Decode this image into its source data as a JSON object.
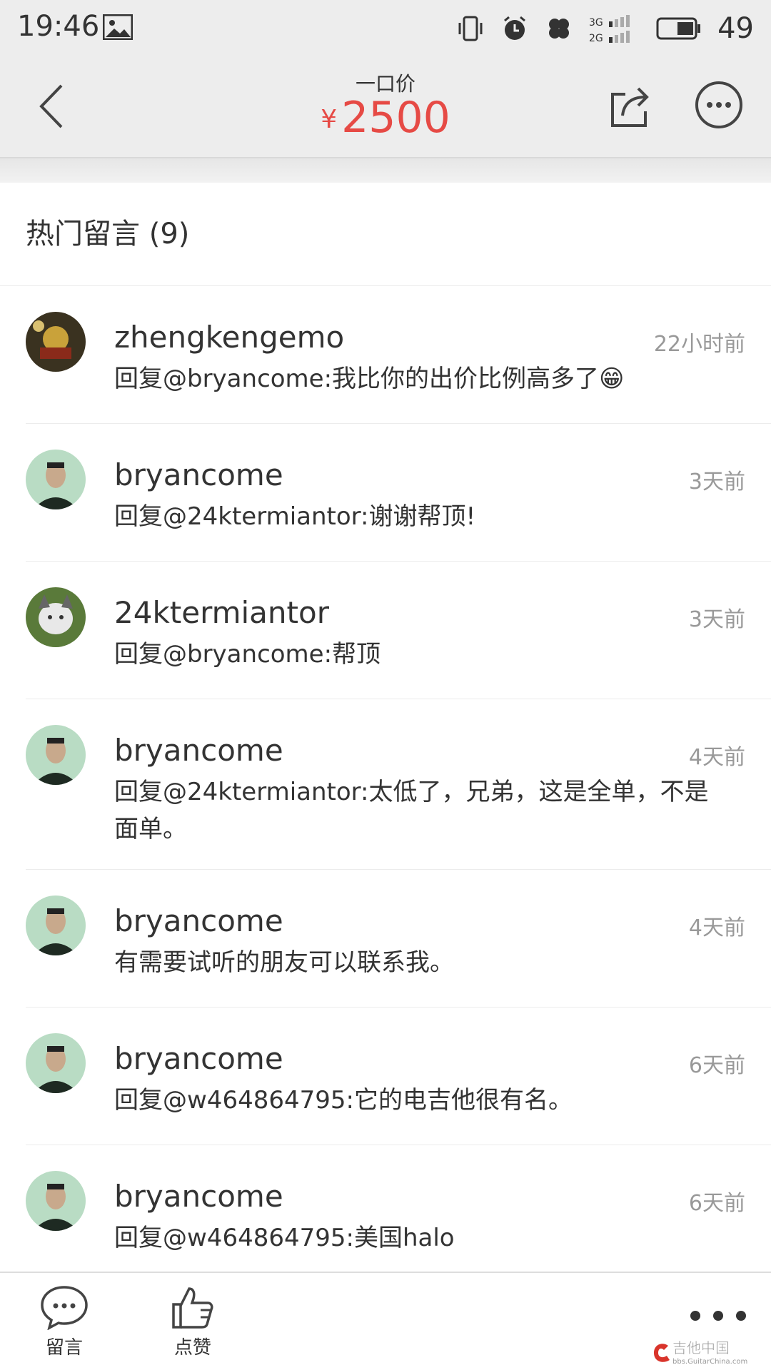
{
  "status_bar": {
    "time": "19:46",
    "battery": "49",
    "network_3g": "3G",
    "network_2g": "2G"
  },
  "nav": {
    "title": "一口价",
    "currency": "¥",
    "price": "2500"
  },
  "section": {
    "title": "热门留言 (9)"
  },
  "comments": [
    {
      "user": "zhengkengemo",
      "time": "22小时前",
      "text": "回复@bryancome:我比你的出价比例高多了😁"
    },
    {
      "user": "bryancome",
      "time": "3天前",
      "text": "回复@24ktermiantor:谢谢帮顶!"
    },
    {
      "user": "24ktermiantor",
      "time": "3天前",
      "text": "回复@bryancome:帮顶"
    },
    {
      "user": "bryancome",
      "time": "4天前",
      "text": "回复@24ktermiantor:太低了，兄弟，这是全单，不是面单。"
    },
    {
      "user": "bryancome",
      "time": "4天前",
      "text": "有需要试听的朋友可以联系我。"
    },
    {
      "user": "bryancome",
      "time": "6天前",
      "text": "回复@w464864795:它的电吉他很有名。"
    },
    {
      "user": "bryancome",
      "time": "6天前",
      "text": "回复@w464864795:美国halo"
    }
  ],
  "bottom": {
    "comment_label": "留言",
    "like_label": "点赞"
  },
  "watermark": {
    "title": "吉他中国",
    "url": "bbs.GuitarChina.com"
  }
}
